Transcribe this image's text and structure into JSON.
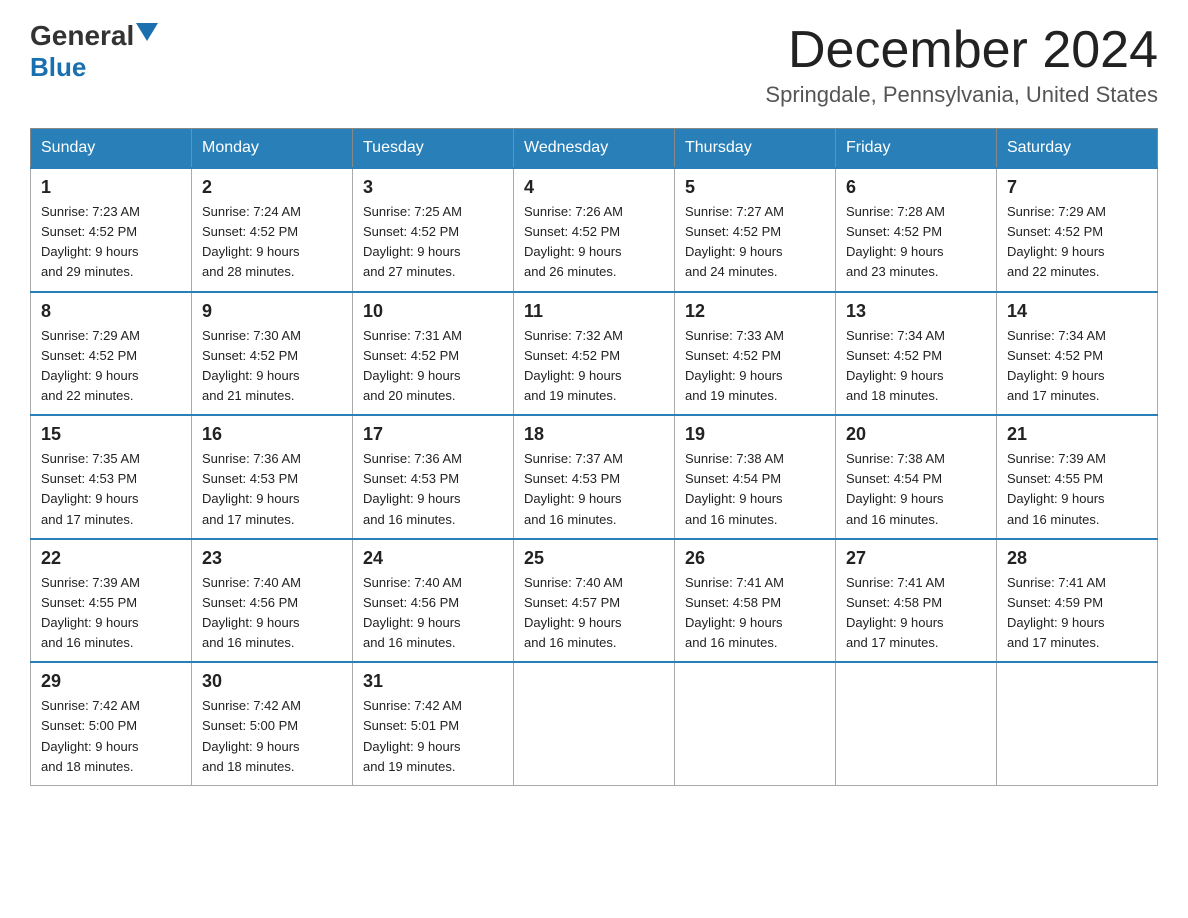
{
  "header": {
    "logo_general": "General",
    "logo_blue": "Blue",
    "month_title": "December 2024",
    "location": "Springdale, Pennsylvania, United States"
  },
  "weekdays": [
    "Sunday",
    "Monday",
    "Tuesday",
    "Wednesday",
    "Thursday",
    "Friday",
    "Saturday"
  ],
  "weeks": [
    [
      {
        "day": "1",
        "sunrise": "7:23 AM",
        "sunset": "4:52 PM",
        "daylight": "9 hours and 29 minutes."
      },
      {
        "day": "2",
        "sunrise": "7:24 AM",
        "sunset": "4:52 PM",
        "daylight": "9 hours and 28 minutes."
      },
      {
        "day": "3",
        "sunrise": "7:25 AM",
        "sunset": "4:52 PM",
        "daylight": "9 hours and 27 minutes."
      },
      {
        "day": "4",
        "sunrise": "7:26 AM",
        "sunset": "4:52 PM",
        "daylight": "9 hours and 26 minutes."
      },
      {
        "day": "5",
        "sunrise": "7:27 AM",
        "sunset": "4:52 PM",
        "daylight": "9 hours and 24 minutes."
      },
      {
        "day": "6",
        "sunrise": "7:28 AM",
        "sunset": "4:52 PM",
        "daylight": "9 hours and 23 minutes."
      },
      {
        "day": "7",
        "sunrise": "7:29 AM",
        "sunset": "4:52 PM",
        "daylight": "9 hours and 22 minutes."
      }
    ],
    [
      {
        "day": "8",
        "sunrise": "7:29 AM",
        "sunset": "4:52 PM",
        "daylight": "9 hours and 22 minutes."
      },
      {
        "day": "9",
        "sunrise": "7:30 AM",
        "sunset": "4:52 PM",
        "daylight": "9 hours and 21 minutes."
      },
      {
        "day": "10",
        "sunrise": "7:31 AM",
        "sunset": "4:52 PM",
        "daylight": "9 hours and 20 minutes."
      },
      {
        "day": "11",
        "sunrise": "7:32 AM",
        "sunset": "4:52 PM",
        "daylight": "9 hours and 19 minutes."
      },
      {
        "day": "12",
        "sunrise": "7:33 AM",
        "sunset": "4:52 PM",
        "daylight": "9 hours and 19 minutes."
      },
      {
        "day": "13",
        "sunrise": "7:34 AM",
        "sunset": "4:52 PM",
        "daylight": "9 hours and 18 minutes."
      },
      {
        "day": "14",
        "sunrise": "7:34 AM",
        "sunset": "4:52 PM",
        "daylight": "9 hours and 17 minutes."
      }
    ],
    [
      {
        "day": "15",
        "sunrise": "7:35 AM",
        "sunset": "4:53 PM",
        "daylight": "9 hours and 17 minutes."
      },
      {
        "day": "16",
        "sunrise": "7:36 AM",
        "sunset": "4:53 PM",
        "daylight": "9 hours and 17 minutes."
      },
      {
        "day": "17",
        "sunrise": "7:36 AM",
        "sunset": "4:53 PM",
        "daylight": "9 hours and 16 minutes."
      },
      {
        "day": "18",
        "sunrise": "7:37 AM",
        "sunset": "4:53 PM",
        "daylight": "9 hours and 16 minutes."
      },
      {
        "day": "19",
        "sunrise": "7:38 AM",
        "sunset": "4:54 PM",
        "daylight": "9 hours and 16 minutes."
      },
      {
        "day": "20",
        "sunrise": "7:38 AM",
        "sunset": "4:54 PM",
        "daylight": "9 hours and 16 minutes."
      },
      {
        "day": "21",
        "sunrise": "7:39 AM",
        "sunset": "4:55 PM",
        "daylight": "9 hours and 16 minutes."
      }
    ],
    [
      {
        "day": "22",
        "sunrise": "7:39 AM",
        "sunset": "4:55 PM",
        "daylight": "9 hours and 16 minutes."
      },
      {
        "day": "23",
        "sunrise": "7:40 AM",
        "sunset": "4:56 PM",
        "daylight": "9 hours and 16 minutes."
      },
      {
        "day": "24",
        "sunrise": "7:40 AM",
        "sunset": "4:56 PM",
        "daylight": "9 hours and 16 minutes."
      },
      {
        "day": "25",
        "sunrise": "7:40 AM",
        "sunset": "4:57 PM",
        "daylight": "9 hours and 16 minutes."
      },
      {
        "day": "26",
        "sunrise": "7:41 AM",
        "sunset": "4:58 PM",
        "daylight": "9 hours and 16 minutes."
      },
      {
        "day": "27",
        "sunrise": "7:41 AM",
        "sunset": "4:58 PM",
        "daylight": "9 hours and 17 minutes."
      },
      {
        "day": "28",
        "sunrise": "7:41 AM",
        "sunset": "4:59 PM",
        "daylight": "9 hours and 17 minutes."
      }
    ],
    [
      {
        "day": "29",
        "sunrise": "7:42 AM",
        "sunset": "5:00 PM",
        "daylight": "9 hours and 18 minutes."
      },
      {
        "day": "30",
        "sunrise": "7:42 AM",
        "sunset": "5:00 PM",
        "daylight": "9 hours and 18 minutes."
      },
      {
        "day": "31",
        "sunrise": "7:42 AM",
        "sunset": "5:01 PM",
        "daylight": "9 hours and 19 minutes."
      },
      null,
      null,
      null,
      null
    ]
  ],
  "labels": {
    "sunrise": "Sunrise:",
    "sunset": "Sunset:",
    "daylight": "Daylight:"
  }
}
